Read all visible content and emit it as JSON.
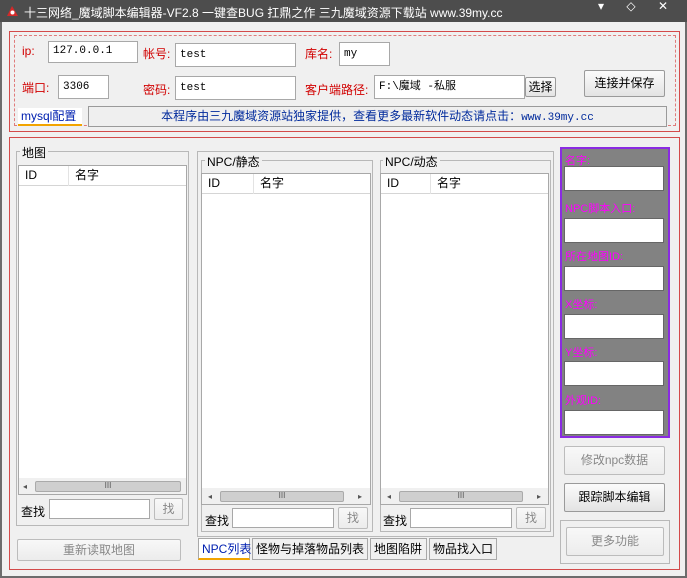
{
  "window": {
    "title": "十三网络_魔域脚本编辑器-VF2.8   一键查BUG 扛鼎之作   三九魔域资源下载站 www.39my.cc",
    "minimize_glyph": "▾",
    "maximize_glyph": "◇",
    "close_glyph": "✕"
  },
  "mysql": {
    "ip_label": "ip:",
    "ip_value": "127.0.0.1",
    "account_label": "帐号:",
    "account_value": "test",
    "db_label": "库名:",
    "db_value": "my",
    "port_label": "端口:",
    "port_value": "3306",
    "password_label": "密码:",
    "password_value": "test",
    "client_path_label": "客户端路径:",
    "client_path_value": "F:\\魔域 -私服",
    "choose_button": "选择",
    "connect_button": "连接并保存",
    "tab_label": "mysql配置",
    "banner_text": "本程序由三九魔域资源站独家提供，查看更多最新软件动态请点击：",
    "banner_link": "www.39my.cc"
  },
  "map_panel": {
    "title": "地图",
    "columns": [
      "ID",
      "名字"
    ],
    "search_label": "查找",
    "search_button": "找",
    "reload_button": "重新读取地图"
  },
  "npc_panel": {
    "title": "NPC/静态",
    "columns": [
      "ID",
      "名字"
    ],
    "search_label": "查找",
    "search_button": "找"
  },
  "npc_dynamic_panel": {
    "title": "NPC/动态",
    "columns": [
      "ID",
      "名字"
    ],
    "search_label": "查找",
    "search_button": "找"
  },
  "scroll_thumb_glyph": "III",
  "bottom_tabs": [
    "NPC列表",
    "怪物与掉落物品列表",
    "地图陷阱",
    "物品找入口"
  ],
  "side_panel": {
    "name_label": "名字:",
    "script_entry_label": "NPC脚本入口:",
    "map_id_label": "所在地图ID:",
    "x_label": "X坐标:",
    "y_label": "Y坐标:",
    "look_id_label": "外观ID:",
    "modify_button": "修改npc数据",
    "trace_button": "跟踪脚本编辑",
    "more_button": "更多功能"
  },
  "colors": {
    "titlebar": "#4d4d4d",
    "label_red": "#d10000",
    "link_blue": "#002a9c",
    "side_label": "#ff00ff",
    "side_border": "#8a2be2",
    "frame_red": "#d34a4a"
  }
}
